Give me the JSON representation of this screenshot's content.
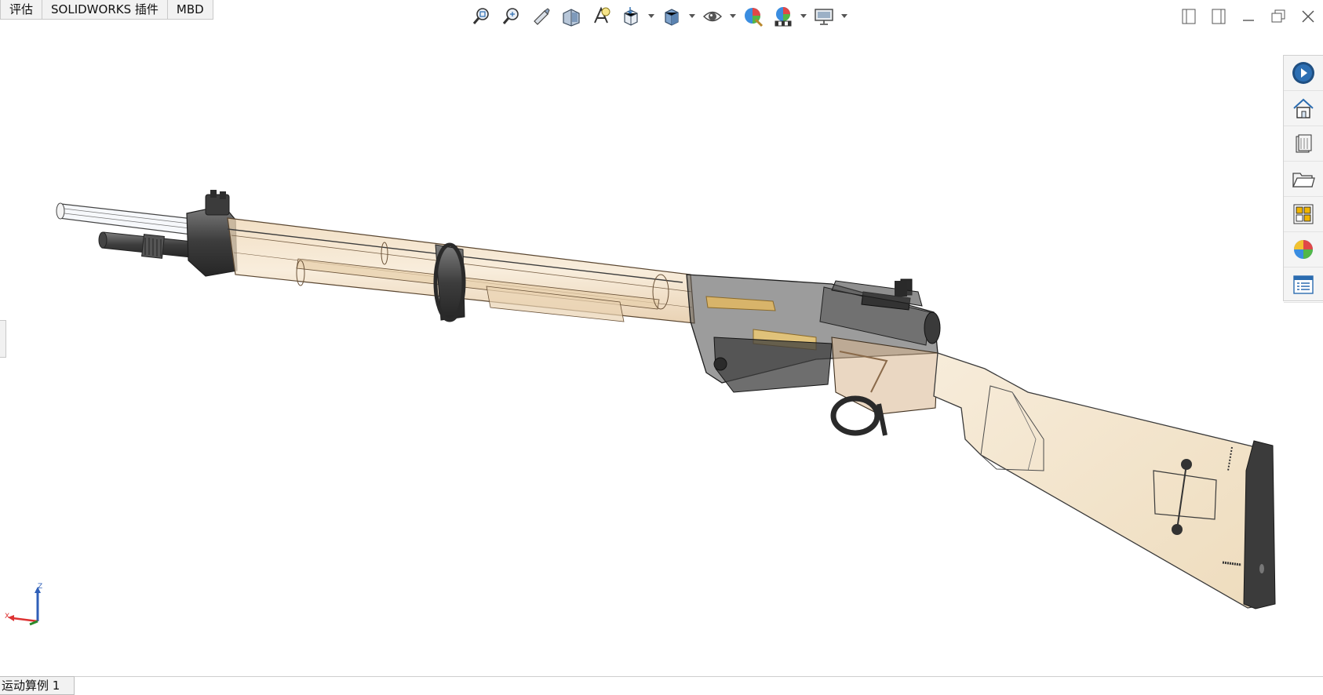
{
  "command_tabs": [
    "评估",
    "SOLIDWORKS 插件",
    "MBD"
  ],
  "hud_tools": [
    {
      "icon": "zoom-to-fit-icon"
    },
    {
      "icon": "zoom-to-area-icon"
    },
    {
      "icon": "previous-view-icon"
    },
    {
      "icon": "section-view-icon"
    },
    {
      "icon": "dynamic-annotation-views-icon"
    },
    {
      "icon": "view-orientation-icon",
      "dropdown": true
    },
    {
      "icon": "display-style-icon",
      "dropdown": true
    },
    {
      "icon": "hide-show-items-icon",
      "dropdown": true
    },
    {
      "icon": "edit-appearance-icon"
    },
    {
      "icon": "apply-scene-icon",
      "dropdown": true
    },
    {
      "icon": "view-settings-icon",
      "dropdown": true
    }
  ],
  "window_controls": [
    "tile-left-icon",
    "tile-right-icon",
    "minimize-icon",
    "restore-icon",
    "close-icon"
  ],
  "task_pane": [
    "solidworks-resources-icon",
    "home-icon",
    "design-library-icon",
    "file-explorer-icon",
    "view-palette-icon",
    "appearances-scenes-icon",
    "custom-properties-icon"
  ],
  "triad": {
    "x": "X",
    "z": "Z"
  },
  "bottom_tabs": [
    "运动算例 1"
  ],
  "colors": {
    "wood": "#f3e4cc",
    "wood_transparent": "#e6c9a1",
    "metal": "#4a4a4a",
    "accent_blue": "#2b6cb0"
  }
}
